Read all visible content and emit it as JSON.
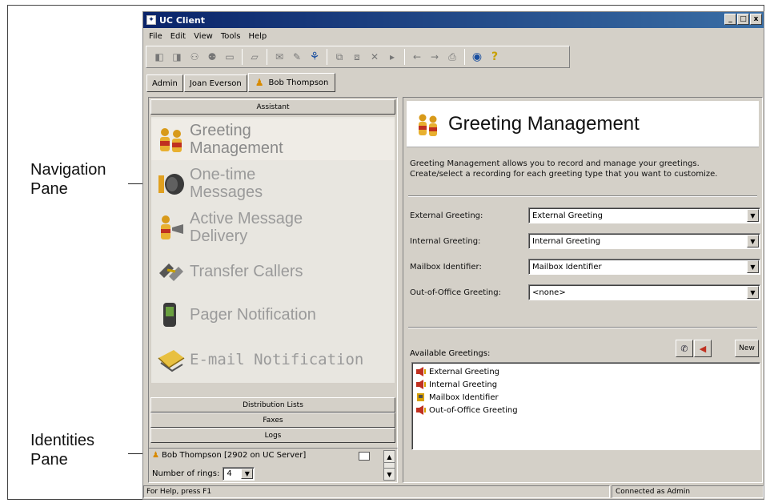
{
  "callouts": {
    "navigation_line1": "Navigation",
    "navigation_line2": "Pane",
    "identities_line1": "Identities",
    "identities_line2": "Pane"
  },
  "window": {
    "title": "UC Client",
    "min_glyph": "_",
    "max_glyph": "□",
    "close_glyph": "x"
  },
  "menu": [
    "File",
    "Edit",
    "View",
    "Tools",
    "Help"
  ],
  "tabs": [
    "Admin",
    "Joan Everson",
    "Bob Thompson"
  ],
  "left_pane": {
    "assistant_header": "Assistant",
    "nav_items": [
      {
        "line1": "Greeting",
        "line2": "Management"
      },
      {
        "line1": "One-time",
        "line2": "Messages"
      },
      {
        "line1": "Active Message",
        "line2": "Delivery"
      },
      {
        "line1": "Transfer Callers"
      },
      {
        "line1": "Pager Notification"
      },
      {
        "line1": "E-mail Notification"
      }
    ],
    "sections": [
      "Distribution Lists",
      "Faxes",
      "Logs"
    ],
    "identity": "Bob Thompson [2902 on UC Server]",
    "rings_label": "Number of rings:",
    "rings_value": "4"
  },
  "right_pane": {
    "title": "Greeting Management",
    "description_line1": "Greeting Management allows you to record and manage your greetings.",
    "description_line2": "Create/select a recording for each greeting type that you want to customize.",
    "fields": [
      {
        "label": "External Greeting:",
        "value": "External Greeting"
      },
      {
        "label": "Internal Greeting:",
        "value": "Internal Greeting"
      },
      {
        "label": "Mailbox Identifier:",
        "value": "Mailbox Identifier"
      },
      {
        "label": "Out-of-Office Greeting:",
        "value": "<none>"
      }
    ],
    "available_label": "Available Greetings:",
    "new_button": "New",
    "greetings": [
      "External Greeting",
      "Internal Greeting",
      "Mailbox Identifier",
      "Out-of-Office Greeting"
    ]
  },
  "status": {
    "help": "For Help, press F1",
    "connection": "Connected as Admin"
  },
  "colors": {
    "title_bar": "#0a246a",
    "window_face": "#d4d0c8",
    "nav_text": "#9a9a9a"
  }
}
